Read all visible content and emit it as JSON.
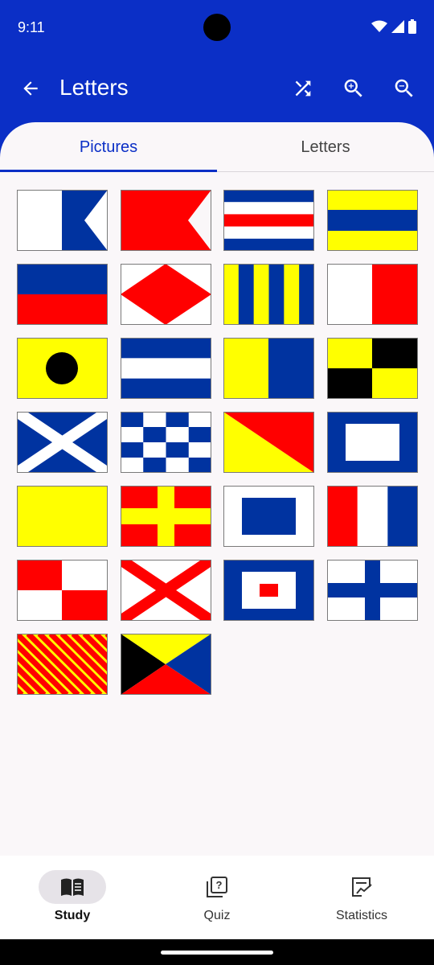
{
  "status_bar": {
    "time": "9:11"
  },
  "toolbar": {
    "title": "Letters",
    "back_icon": "arrow-back-icon",
    "shuffle_icon": "shuffle-icon",
    "zoom_in_icon": "zoom-in-icon",
    "zoom_out_icon": "zoom-out-icon"
  },
  "tabs": [
    {
      "label": "Pictures",
      "active": true
    },
    {
      "label": "Letters",
      "active": false
    }
  ],
  "flags": [
    {
      "letter": "A",
      "design": "alfa"
    },
    {
      "letter": "B",
      "design": "bravo"
    },
    {
      "letter": "C",
      "design": "charlie"
    },
    {
      "letter": "D",
      "design": "delta"
    },
    {
      "letter": "E",
      "design": "echo"
    },
    {
      "letter": "F",
      "design": "foxtrot"
    },
    {
      "letter": "G",
      "design": "golf"
    },
    {
      "letter": "H",
      "design": "hotel"
    },
    {
      "letter": "I",
      "design": "india"
    },
    {
      "letter": "J",
      "design": "juliet"
    },
    {
      "letter": "K",
      "design": "kilo"
    },
    {
      "letter": "L",
      "design": "lima"
    },
    {
      "letter": "M",
      "design": "mike"
    },
    {
      "letter": "N",
      "design": "november"
    },
    {
      "letter": "O",
      "design": "oscar"
    },
    {
      "letter": "P",
      "design": "papa"
    },
    {
      "letter": "Q",
      "design": "quebec"
    },
    {
      "letter": "R",
      "design": "romeo"
    },
    {
      "letter": "S",
      "design": "sierra"
    },
    {
      "letter": "T",
      "design": "tango"
    },
    {
      "letter": "U",
      "design": "uniform"
    },
    {
      "letter": "V",
      "design": "victor"
    },
    {
      "letter": "W",
      "design": "whiskey"
    },
    {
      "letter": "X",
      "design": "xray"
    },
    {
      "letter": "Y",
      "design": "yankee"
    },
    {
      "letter": "Z",
      "design": "zulu"
    }
  ],
  "bottom_nav": [
    {
      "label": "Study",
      "icon": "book-icon",
      "active": true
    },
    {
      "label": "Quiz",
      "icon": "quiz-icon",
      "active": false
    },
    {
      "label": "Statistics",
      "icon": "statistics-icon",
      "active": false
    }
  ],
  "colors": {
    "primary": "#0b2fc6",
    "flag_blue": "#0033a0",
    "flag_red": "#ff0000",
    "flag_yellow": "#ffff00"
  }
}
